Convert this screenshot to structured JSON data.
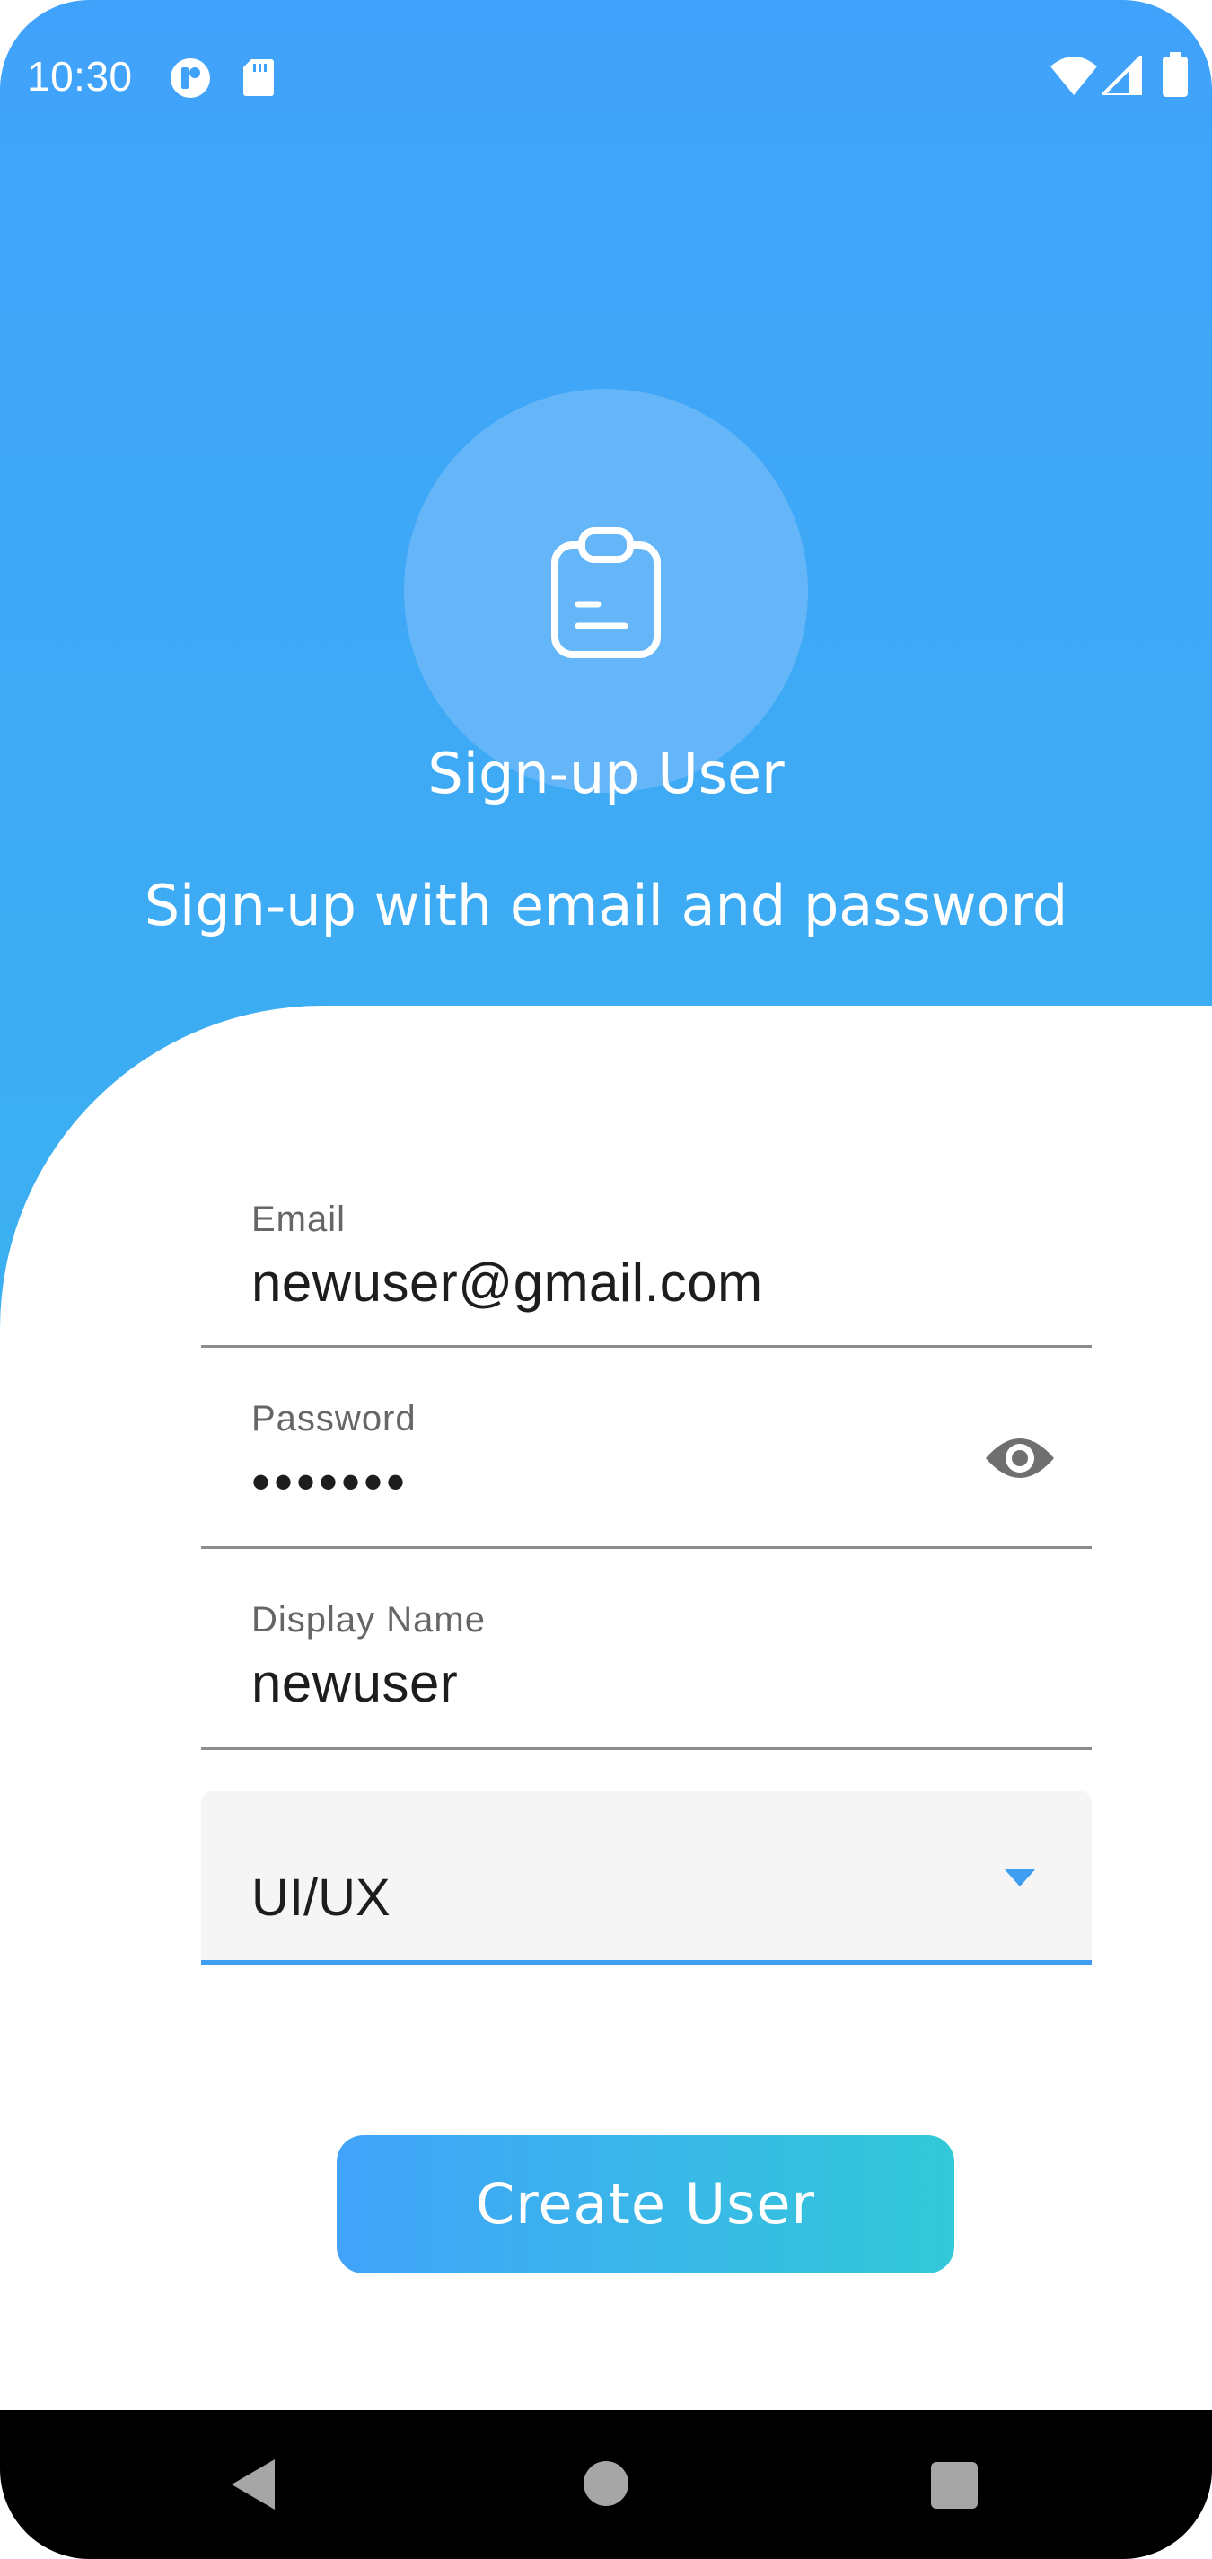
{
  "status_bar": {
    "time": "10:30",
    "icons": [
      "app-notification-icon",
      "sd-card-icon",
      "wifi-icon",
      "cellular-signal-icon",
      "battery-icon"
    ]
  },
  "header": {
    "icon": "clipboard-icon",
    "title": "Sign-up User",
    "subtitle": "Sign-up with email and password"
  },
  "form": {
    "email": {
      "label": "Email",
      "value": "newuser@gmail.com"
    },
    "password": {
      "label": "Password",
      "value": "•••••••",
      "toggle_icon": "eye-icon"
    },
    "display_name": {
      "label": "Display Name",
      "value": "newuser"
    },
    "role": {
      "selected": "UI/UX",
      "arrow_icon": "dropdown-arrow-icon"
    }
  },
  "create_button": {
    "label": "Create User"
  },
  "colors": {
    "primary_blue": "#41a2fb",
    "accent_teal": "#32c9d8",
    "header_circle": "#64b6f8"
  },
  "nav_bar": {
    "icons": [
      "back-icon",
      "home-icon",
      "recents-icon"
    ]
  }
}
